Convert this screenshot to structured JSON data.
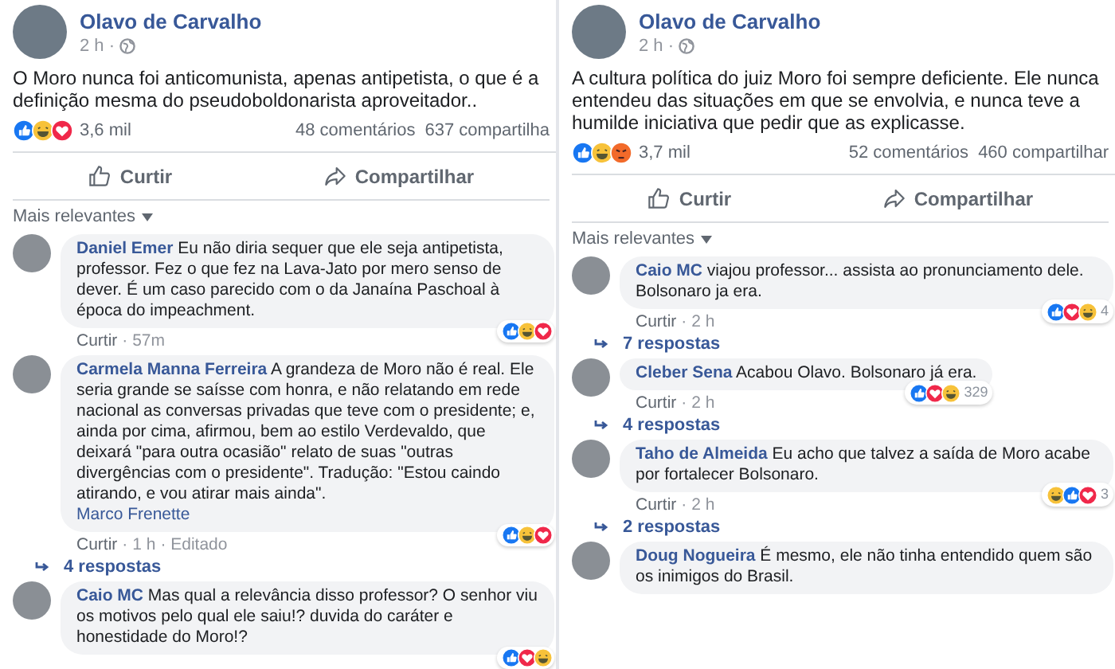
{
  "posts": [
    {
      "author": "Olavo de Carvalho",
      "time": "2 h ·",
      "text": "O Moro nunca foi anticomunista, apenas antipetista, o que é a definição mesma do pseudoboldonarista aproveitador..",
      "reactions": [
        {
          "kind": "like"
        },
        {
          "kind": "haha"
        },
        {
          "kind": "love"
        }
      ],
      "reaction_count": "3,6 mil",
      "comments_count": "48 comentários",
      "shares_count": "637 compartilha",
      "actions": [
        {
          "kind": "like",
          "label": "Curtir"
        },
        {
          "kind": "share",
          "label": "Compartilhar"
        }
      ],
      "sort_label": "Mais relevantes",
      "comments": [
        {
          "author": "Daniel Emer",
          "text": "Eu não diria sequer que ele seja antipetista, professor. Fez o que fez na Lava-Jato por mero senso de dever. É um caso parecido com o da Janaína Paschoal à época do impeachment.",
          "like_label": "Curtir",
          "time": "· 57m",
          "reactions": [
            {
              "kind": "like"
            },
            {
              "kind": "haha"
            },
            {
              "kind": "love"
            }
          ]
        },
        {
          "author": "Carmela Manna Ferreira",
          "text": "A grandeza de Moro não é real. Ele seria grande se saísse com honra, e não relatando em rede nacional as conversas privadas que teve com o presidente; e, ainda por cima, afirmou, bem ao estilo Verdevaldo, que deixará \"para outra ocasião\" relato de suas \"outras divergências com o presidente\". Tradução: \"Estou caindo atirando, e vou atirar mais ainda\".",
          "tag": "Marco Frenette",
          "like_label": "Curtir",
          "time": "· 1 h",
          "edited": "· Editado",
          "reactions": [
            {
              "kind": "like"
            },
            {
              "kind": "haha"
            },
            {
              "kind": "love"
            }
          ],
          "replies": "4 respostas"
        },
        {
          "author": "Caio MC",
          "text": "Mas qual a relevância disso professor? O senhor viu os motivos pelo qual ele saiu!? duvida do caráter e honestidade do Moro!?",
          "reactions": [
            {
              "kind": "like"
            },
            {
              "kind": "love"
            },
            {
              "kind": "haha"
            }
          ]
        }
      ]
    },
    {
      "author": "Olavo de Carvalho",
      "time": "2 h ·",
      "text": "A cultura política do juiz Moro foi sempre deficiente. Ele nunca entendeu das situações em que se envolvia, e nunca teve a humilde iniciativa que pedir que as explicasse.",
      "reactions": [
        {
          "kind": "like"
        },
        {
          "kind": "haha"
        },
        {
          "kind": "angry"
        }
      ],
      "reaction_count": "3,7 mil",
      "comments_count": "52 comentários",
      "shares_count": "460 compartilhar",
      "actions": [
        {
          "kind": "like",
          "label": "Curtir"
        },
        {
          "kind": "share",
          "label": "Compartilhar"
        }
      ],
      "sort_label": "Mais relevantes",
      "comments": [
        {
          "author": "Caio MC",
          "text": "viajou professor... assista ao pronunciamento dele. Bolsonaro ja era.",
          "like_label": "Curtir",
          "time": "· 2 h",
          "reactions": [
            {
              "kind": "like"
            },
            {
              "kind": "love"
            },
            {
              "kind": "haha"
            }
          ],
          "reaction_count": "4",
          "replies": "7 respostas"
        },
        {
          "author": "Cleber Sena",
          "text": "Acabou Olavo. Bolsonaro já era.",
          "like_label": "Curtir",
          "time": "· 2 h",
          "reactions": [
            {
              "kind": "like"
            },
            {
              "kind": "love"
            },
            {
              "kind": "haha"
            }
          ],
          "reaction_count": "329",
          "replies": "4 respostas"
        },
        {
          "author": "Taho de Almeida",
          "text": "Eu acho que talvez a saída de Moro acabe por fortalecer Bolsonaro.",
          "like_label": "Curtir",
          "time": "· 2 h",
          "reactions": [
            {
              "kind": "haha"
            },
            {
              "kind": "like"
            },
            {
              "kind": "love"
            }
          ],
          "reaction_count": "3",
          "replies": "2 respostas"
        },
        {
          "author": "Doug Nogueira",
          "text": "É mesmo, ele não tinha entendido quem são os inimigos do Brasil."
        }
      ]
    }
  ]
}
